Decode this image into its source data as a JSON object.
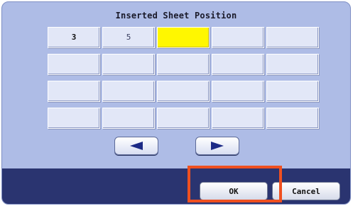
{
  "dialog": {
    "title": "Inserted Sheet Position"
  },
  "grid": {
    "rows": [
      [
        "3",
        "5",
        "",
        "",
        ""
      ],
      [
        "",
        "",
        "",
        "",
        ""
      ],
      [
        "",
        "",
        "",
        "",
        ""
      ],
      [
        "",
        "",
        "",
        "",
        ""
      ]
    ],
    "current_cell": "row 1, column 3"
  },
  "navigation": {
    "left_icon": "arrow-left-icon",
    "right_icon": "arrow-right-icon"
  },
  "actions": {
    "ok_label": "OK",
    "cancel_label": "Cancel"
  },
  "colors": {
    "panel_background": "#aebce6",
    "bottom_bar": "#2a3470",
    "current_cell": "#fff700",
    "highlight_frame": "#ef5020"
  }
}
